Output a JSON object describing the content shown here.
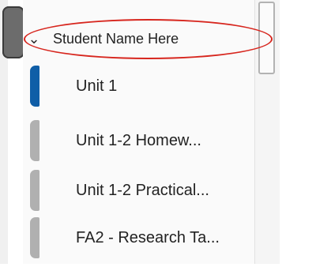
{
  "header": {
    "title": "Student Name Here"
  },
  "pages": [
    {
      "label": "Unit 1",
      "state": "active"
    },
    {
      "label": "Unit 1-2 Homew...",
      "state": "inactive"
    },
    {
      "label": "Unit 1-2 Practical...",
      "state": "inactive"
    },
    {
      "label": "FA2 - Research Ta...",
      "state": "inactive"
    }
  ],
  "colors": {
    "active_accent": "#0f5ea7",
    "inactive_tab": "#b0b0b0",
    "highlight_ellipse": "#d7261e"
  },
  "icons": {
    "expand": "chevron-down-icon"
  }
}
